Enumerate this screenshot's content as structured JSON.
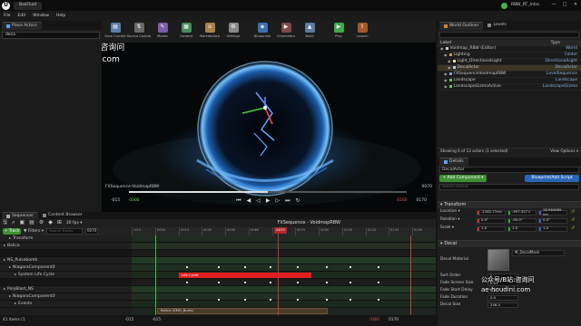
{
  "window": {
    "app_logo": "ue-logo",
    "level_tab": "BoxFluid",
    "project_name": "RBW_RT_Intro",
    "min": "—",
    "max": "□",
    "close": "✕"
  },
  "menu": [
    "File",
    "Edit",
    "Window",
    "Help"
  ],
  "left_panel": {
    "tab": "Place Actors",
    "search_value": "deca"
  },
  "toolbar": {
    "items": [
      {
        "label": "Save Current",
        "icon": "save-icon"
      },
      {
        "label": "Source Control",
        "icon": "source-control-icon"
      },
      {
        "label": "Modes",
        "icon": "modes-icon"
      },
      {
        "label": "Content",
        "icon": "content-icon"
      },
      {
        "label": "Marketplace",
        "icon": "marketplace-icon"
      },
      {
        "label": "Settings",
        "icon": "settings-icon"
      },
      {
        "label": "Blueprints",
        "icon": "blueprints-icon"
      },
      {
        "label": "Cinematics",
        "icon": "cinematics-icon"
      },
      {
        "label": "Build",
        "icon": "build-icon"
      },
      {
        "label": "Play",
        "icon": "play-icon"
      },
      {
        "label": "Launch",
        "icon": "launch-icon"
      }
    ]
  },
  "watermark": {
    "line1": "公众号/B站:咨询问",
    "line2": "ae-houdini.com",
    "line3": "公众号/B站:咨询问",
    "line4": "ae-houdini.com"
  },
  "viewport": {
    "sequence_name": "FXSequence-VoidmapRBW",
    "frame_right": "0070",
    "frame_start": "-015",
    "frame_start_green": "0000",
    "frame_end_red": "0160",
    "frame_end": "0170",
    "accent_blue": "#4a9fff"
  },
  "outliner": {
    "tab1": "World Outliner",
    "tab2": "Levels",
    "col_label": "Label",
    "col_type": "Type",
    "rows": [
      {
        "label": "Voidmap_RBW (Editor)",
        "type": "World"
      },
      {
        "label": "Lighting",
        "type": "Folder"
      },
      {
        "label": "Light_DirectionalLight",
        "type": "DirectionalLight"
      },
      {
        "label": "DecalActor",
        "type": "DecalActor"
      },
      {
        "label": "FXSequenceVoidmapRBW",
        "type": "LevelSequence"
      },
      {
        "label": "Landscape",
        "type": "Landscape"
      },
      {
        "label": "LandscapeGizmoActive",
        "type": "LandscapeGizmo"
      }
    ],
    "status": "Showing 6 of 13 actors (1 selected)",
    "view_options": "View Options ▾"
  },
  "details": {
    "tab": "Details",
    "actor_name": "DecalActor",
    "add_component": "+ Add Component ▾",
    "blueprint_button": "Blueprint/Add Script",
    "search_placeholder": "Search Details",
    "transform_header": "Transform",
    "location_label": "Location ▾",
    "rotation_label": "Rotation ▾",
    "scale_label": "Scale ▾",
    "location": [
      "-1182.77cm",
      "-997.527 c",
      "28.964969 cm"
    ],
    "rotation": [
      "0.0°",
      "-90.0°",
      "0.0°"
    ],
    "scale": [
      "1.0",
      "1.0",
      "1.0"
    ],
    "decal_header": "Decal",
    "decal_material_label": "Decal Material",
    "decal_material_value": "M_DecalMask",
    "sort_order_label": "Sort Order",
    "sort_order": "0",
    "fade_screen_size_label": "Fade Screen Size",
    "fade_screen_size": "0.01",
    "fade_start_delay_label": "Fade Start Delay",
    "fade_start_delay": "0.0",
    "fade_duration_label": "Fade Duration",
    "fade_duration": "0.0",
    "decal_size_label": "Decal Size",
    "decal_size": "256.0"
  },
  "sequencer": {
    "tab1": "Sequencer",
    "tab2": "Content Browser",
    "fps": "30 fps ▾",
    "sequence_title": "FXSequence - VoidmapRBW",
    "track_button": "+ Track",
    "filters": "▼ Filters ▾",
    "search_placeholder": "Search Tracks",
    "current_frame": "0070",
    "frame_input": "0070",
    "tick_labels": [
      "-015",
      "0000",
      "0015",
      "0030",
      "0045",
      "0060",
      "0070",
      "0075",
      "0090",
      "0105",
      "0120",
      "0135",
      "0150"
    ],
    "tracks": [
      {
        "label": "Transform",
        "indent": 1
      },
      {
        "label": "Belica",
        "indent": 0
      },
      {
        "label": "",
        "indent": 0
      },
      {
        "label": "NS_Pulsebomb",
        "indent": 0
      },
      {
        "label": "NiagaraComponent0",
        "indent": 1
      },
      {
        "label": "System Life Cycle",
        "indent": 2
      },
      {
        "label": "",
        "indent": 0
      },
      {
        "label": "PolyBlast_NS",
        "indent": 0
      },
      {
        "label": "NiagaraComponent0",
        "indent": 1
      },
      {
        "label": "Events",
        "indent": 2
      }
    ],
    "items_count": "41 items (1",
    "lifecycle_label": "Life Cycle",
    "belica_clip_label": "Belica (SMG_Burst)",
    "bottom_left": "-015",
    "bottom_mid": "-015",
    "bottom_right_1": "0160",
    "bottom_right_2": "0170",
    "playhead_color": "#d03030",
    "lifecycle_color": "#e02020"
  }
}
